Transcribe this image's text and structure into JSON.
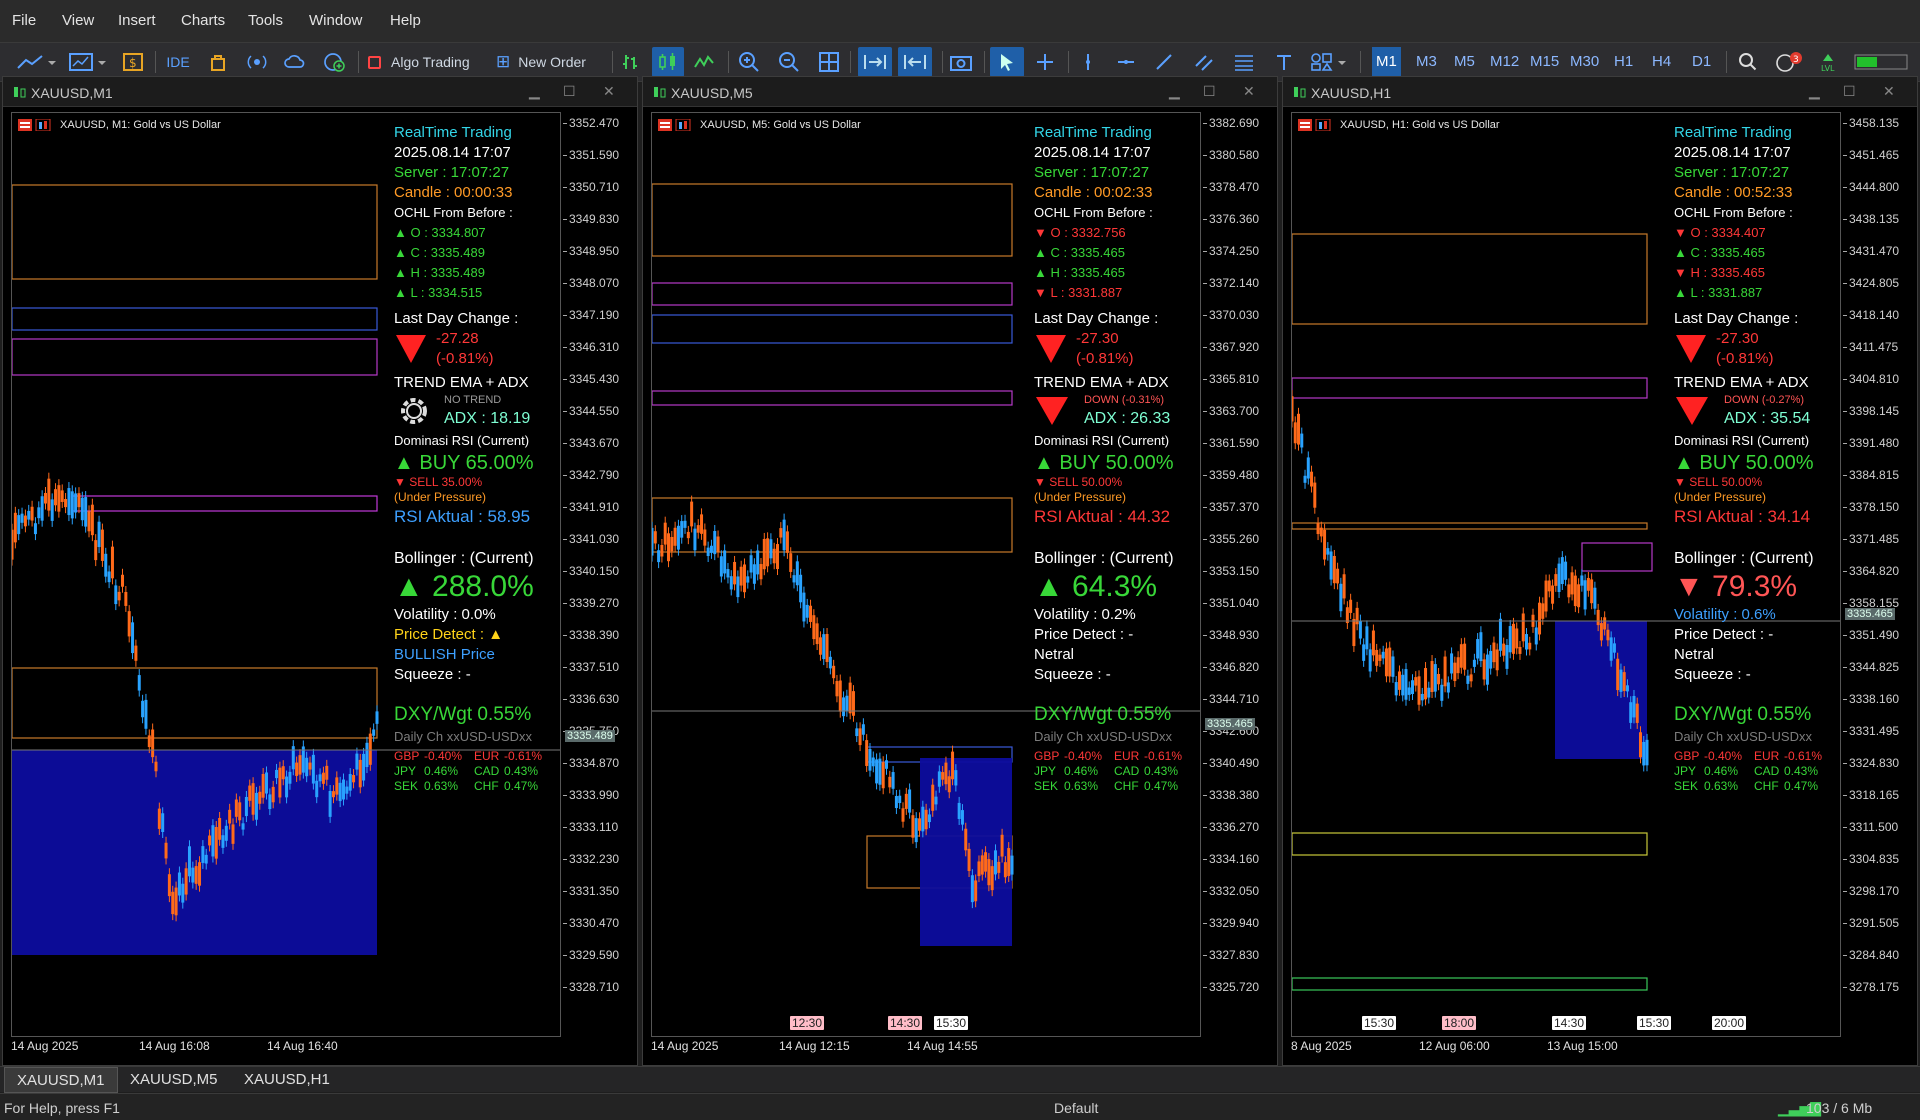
{
  "menu": [
    "File",
    "View",
    "Insert",
    "Charts",
    "Tools",
    "Window",
    "Help"
  ],
  "toolbar": {
    "ide": "IDE",
    "algo_trading": "Algo Trading",
    "new_order": "New Order",
    "timeframes": [
      "M1",
      "M3",
      "M5",
      "M12",
      "M15",
      "M30",
      "H1",
      "H4",
      "D1"
    ],
    "active_timeframe": "M1",
    "notification_count": "3"
  },
  "windows": [
    {
      "title": "XAUUSD,M1",
      "symbol_line": "XAUUSD, M1:  Gold vs US Dollar",
      "price_ticks": [
        "3352.470",
        "3351.590",
        "3350.710",
        "3349.830",
        "3348.950",
        "3348.070",
        "3347.190",
        "3346.310",
        "3345.430",
        "3344.550",
        "3343.670",
        "3342.790",
        "3341.910",
        "3341.030",
        "3340.150",
        "3339.270",
        "3338.390",
        "3337.510",
        "3336.630",
        "3335.750",
        "3334.870",
        "3333.990",
        "3333.110",
        "3332.230",
        "3331.350",
        "3330.470",
        "3329.590",
        "3328.710"
      ],
      "current_price": "3335.489",
      "time_labels": [
        "14 Aug 2025",
        "14 Aug 16:08",
        "14 Aug 16:40"
      ],
      "session_labels": [],
      "panel": {
        "title": "RealTime Trading",
        "date": "2025.08.14 17:07",
        "server": "Server : 17:07:27",
        "candle": "Candle : 00:00:33",
        "ochl_title": "OCHL From Before :",
        "o": {
          "text": "O : 3334.807",
          "dir": "up"
        },
        "c": {
          "text": "C : 3335.489",
          "dir": "up"
        },
        "h": {
          "text": "H : 3335.489",
          "dir": "up"
        },
        "l": {
          "text": "L : 3334.515",
          "dir": "up"
        },
        "last_day_title": "Last Day Change :",
        "last_day_value": "-27.28",
        "last_day_pct": "(-0.81%)",
        "trend_title": "TREND EMA + ADX",
        "trend_state": "NO TREND",
        "adx": "ADX : 18.19",
        "rsi_title": "Dominasi RSI (Current)",
        "buy": "BUY 65.00%",
        "sell": "SELL 35.00%",
        "pressure": "(Under Pressure)",
        "rsi_value": "RSI Aktual : 58.95",
        "boll_title": "Bollinger : (Current)",
        "boll_value": "288.0%",
        "volatility": "Volatility : 0.0%",
        "price_detect": "Price Detect : ▲",
        "price_state": "BULLISH Price",
        "squeeze": "Squeeze : -",
        "dxy": "DXY/Wgt 0.55%",
        "daily": "Daily Ch xxUSD-USDxx",
        "fx": [
          [
            "GBP",
            "-0.40%",
            "EUR",
            "-0.61%"
          ],
          [
            "JPY",
            "0.46%",
            "CAD",
            "0.43%"
          ],
          [
            "SEK",
            "0.63%",
            "CHF",
            "0.47%"
          ]
        ]
      }
    },
    {
      "title": "XAUUSD,M5",
      "symbol_line": "XAUUSD, M5:  Gold vs US Dollar",
      "price_ticks": [
        "3382.690",
        "3380.580",
        "3378.470",
        "3376.360",
        "3374.250",
        "3372.140",
        "3370.030",
        "3367.920",
        "3365.810",
        "3363.700",
        "3361.590",
        "3359.480",
        "3357.370",
        "3355.260",
        "3353.150",
        "3351.040",
        "3348.930",
        "3346.820",
        "3344.710",
        "3342.600",
        "3340.490",
        "3338.380",
        "3336.270",
        "3334.160",
        "3332.050",
        "3329.940",
        "3327.830",
        "3325.720"
      ],
      "current_price": "3335.465",
      "time_labels": [
        "14 Aug 2025",
        "14 Aug 12:15",
        "14 Aug 14:55"
      ],
      "session_labels": [
        "12:30",
        "14:30",
        "15:30"
      ],
      "panel": {
        "title": "RealTime Trading",
        "date": "2025.08.14 17:07",
        "server": "Server : 17:07:27",
        "candle": "Candle : 00:02:33",
        "ochl_title": "OCHL From Before :",
        "o": {
          "text": "O : 3332.756",
          "dir": "down"
        },
        "c": {
          "text": "C : 3335.465",
          "dir": "up"
        },
        "h": {
          "text": "H : 3335.465",
          "dir": "up"
        },
        "l": {
          "text": "L : 3331.887",
          "dir": "down"
        },
        "last_day_title": "Last Day Change :",
        "last_day_value": "-27.30",
        "last_day_pct": "(-0.81%)",
        "trend_title": "TREND EMA + ADX",
        "trend_state": "DOWN (-0.31%)",
        "adx": "ADX : 26.33",
        "rsi_title": "Dominasi RSI (Current)",
        "buy": "BUY 50.00%",
        "sell": "SELL 50.00%",
        "pressure": "(Under Pressure)",
        "rsi_value": "RSI Aktual : 44.32",
        "boll_title": "Bollinger : (Current)",
        "boll_value": "64.3%",
        "volatility": "Volatility : 0.2%",
        "price_detect": "Price Detect : -",
        "price_state": "Netral",
        "squeeze": "Squeeze : -",
        "dxy": "DXY/Wgt 0.55%",
        "daily": "Daily Ch xxUSD-USDxx",
        "fx": [
          [
            "GBP",
            "-0.40%",
            "EUR",
            "-0.61%"
          ],
          [
            "JPY",
            "0.46%",
            "CAD",
            "0.43%"
          ],
          [
            "SEK",
            "0.63%",
            "CHF",
            "0.47%"
          ]
        ]
      }
    },
    {
      "title": "XAUUSD,H1",
      "symbol_line": "XAUUSD, H1:  Gold vs US Dollar",
      "price_ticks": [
        "3458.135",
        "3451.465",
        "3444.800",
        "3438.135",
        "3431.470",
        "3424.805",
        "3418.140",
        "3411.475",
        "3404.810",
        "3398.145",
        "3391.480",
        "3384.815",
        "3378.150",
        "3371.485",
        "3364.820",
        "3358.155",
        "3351.490",
        "3344.825",
        "3338.160",
        "3331.495",
        "3324.830",
        "3318.165",
        "3311.500",
        "3304.835",
        "3298.170",
        "3291.505",
        "3284.840",
        "3278.175"
      ],
      "current_price": "3335.465",
      "time_labels": [
        "8 Aug 2025",
        "12 Aug 06:00",
        "13 Aug 15:00"
      ],
      "session_labels": [
        "15:30",
        "18:00",
        "14:30",
        "15:30",
        "20:00"
      ],
      "panel": {
        "title": "RealTime Trading",
        "date": "2025.08.14 17:07",
        "server": "Server : 17:07:27",
        "candle": "Candle : 00:52:33",
        "ochl_title": "OCHL From Before :",
        "o": {
          "text": "O : 3334.407",
          "dir": "down"
        },
        "c": {
          "text": "C : 3335.465",
          "dir": "up"
        },
        "h": {
          "text": "H : 3335.465",
          "dir": "down"
        },
        "l": {
          "text": "L : 3331.887",
          "dir": "up"
        },
        "last_day_title": "Last Day Change :",
        "last_day_value": "-27.30",
        "last_day_pct": "(-0.81%)",
        "trend_title": "TREND EMA + ADX",
        "trend_state": "DOWN (-0.27%)",
        "adx": "ADX : 35.54",
        "rsi_title": "Dominasi RSI (Current)",
        "buy": "BUY 50.00%",
        "sell": "SELL 50.00%",
        "pressure": "(Under Pressure)",
        "rsi_value": "RSI Aktual : 34.14",
        "boll_title": "Bollinger : (Current)",
        "boll_value": "79.3%",
        "volatility": "Volatility : 0.6%",
        "price_detect": "Price Detect : -",
        "price_state": "Netral",
        "squeeze": "Squeeze : -",
        "dxy": "DXY/Wgt 0.55%",
        "daily": "Daily Ch xxUSD-USDxx",
        "fx": [
          [
            "GBP",
            "-0.40%",
            "EUR",
            "-0.61%"
          ],
          [
            "JPY",
            "0.46%",
            "CAD",
            "0.43%"
          ],
          [
            "SEK",
            "0.63%",
            "CHF",
            "0.47%"
          ]
        ]
      }
    }
  ],
  "tabs": [
    "XAUUSD,M1",
    "XAUUSD,M5",
    "XAUUSD,H1"
  ],
  "active_tab": "XAUUSD,M1",
  "status": {
    "help": "For Help, press F1",
    "profile": "Default",
    "traffic": "103 / 6 Mb"
  },
  "colors": {
    "up_candle": "#29a3ff",
    "down_candle": "#ff6a1a",
    "zone_fill": "#0d0d9e",
    "accent": "#1f5fa8"
  }
}
